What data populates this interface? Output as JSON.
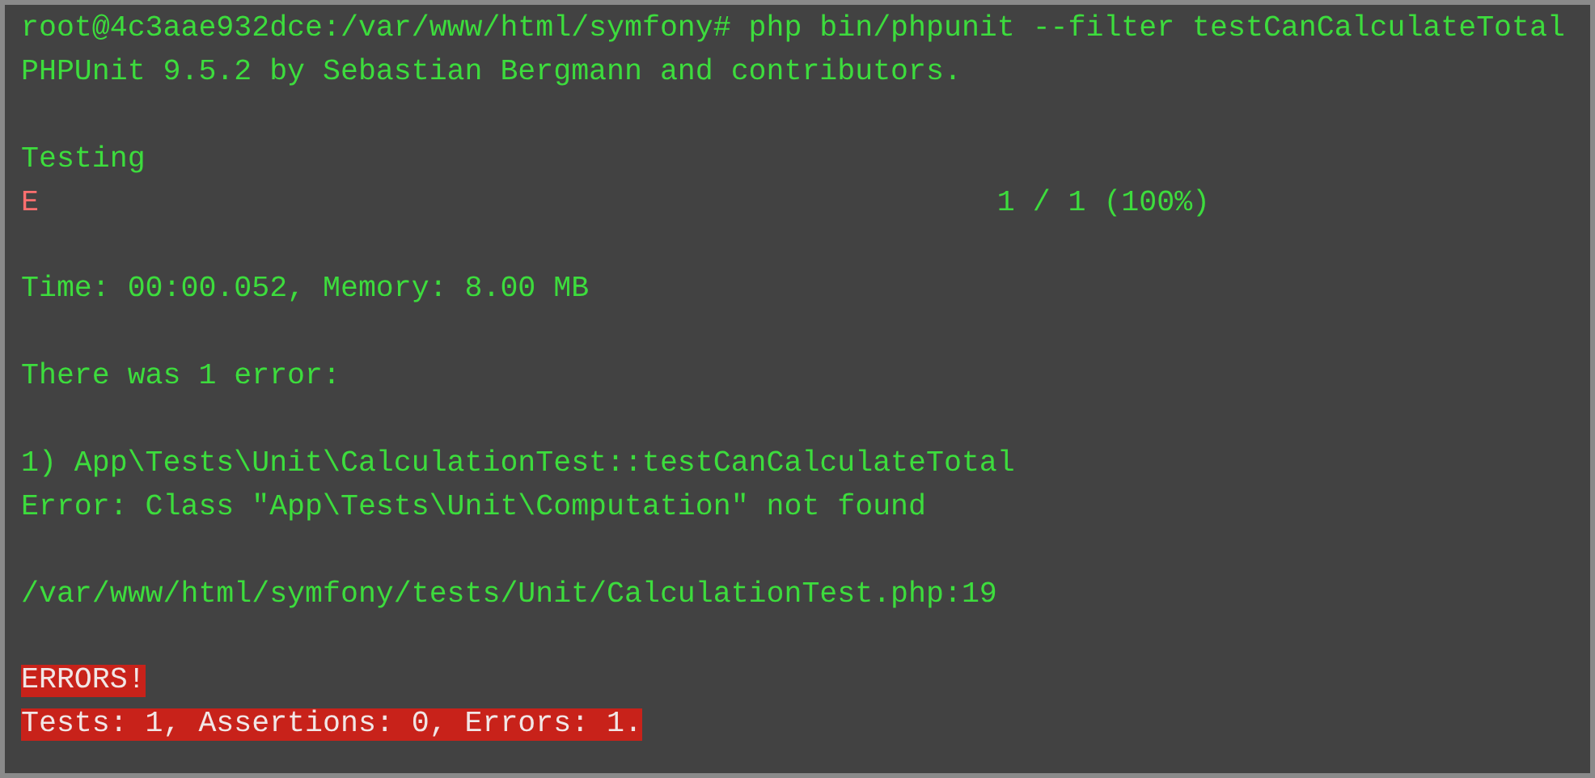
{
  "terminal": {
    "blocks": [
      {
        "lines": [
          {
            "kind": "output",
            "text": "root@4c3aae932dce:/var/www/html/symfony# php bin/phpunit --filter testCanCalculateTotal"
          },
          {
            "kind": "output",
            "text": "PHPUnit 9.5.2 by Sebastian Bergmann and contributors."
          }
        ]
      },
      {
        "lines": [
          {
            "kind": "output",
            "text": "Testing"
          },
          {
            "kind": "progress",
            "text": "E",
            "progress": "1 / 1 (100%)"
          }
        ]
      },
      {
        "lines": [
          {
            "kind": "output",
            "text": "Time: 00:00.052, Memory: 8.00 MB"
          }
        ]
      },
      {
        "lines": [
          {
            "kind": "output",
            "text": "There was 1 error:"
          }
        ]
      },
      {
        "lines": [
          {
            "kind": "output",
            "text": "1) App\\Tests\\Unit\\CalculationTest::testCanCalculateTotal"
          },
          {
            "kind": "output",
            "text": "Error: Class \"App\\Tests\\Unit\\Computation\" not found"
          }
        ]
      },
      {
        "lines": [
          {
            "kind": "output",
            "text": "/var/www/html/symfony/tests/Unit/CalculationTest.php:19"
          }
        ]
      },
      {
        "lines": [
          {
            "kind": "banner",
            "text": "ERRORS!"
          },
          {
            "kind": "banner",
            "text": "Tests: 1, Assertions: 0, Errors: 1."
          }
        ]
      }
    ]
  }
}
